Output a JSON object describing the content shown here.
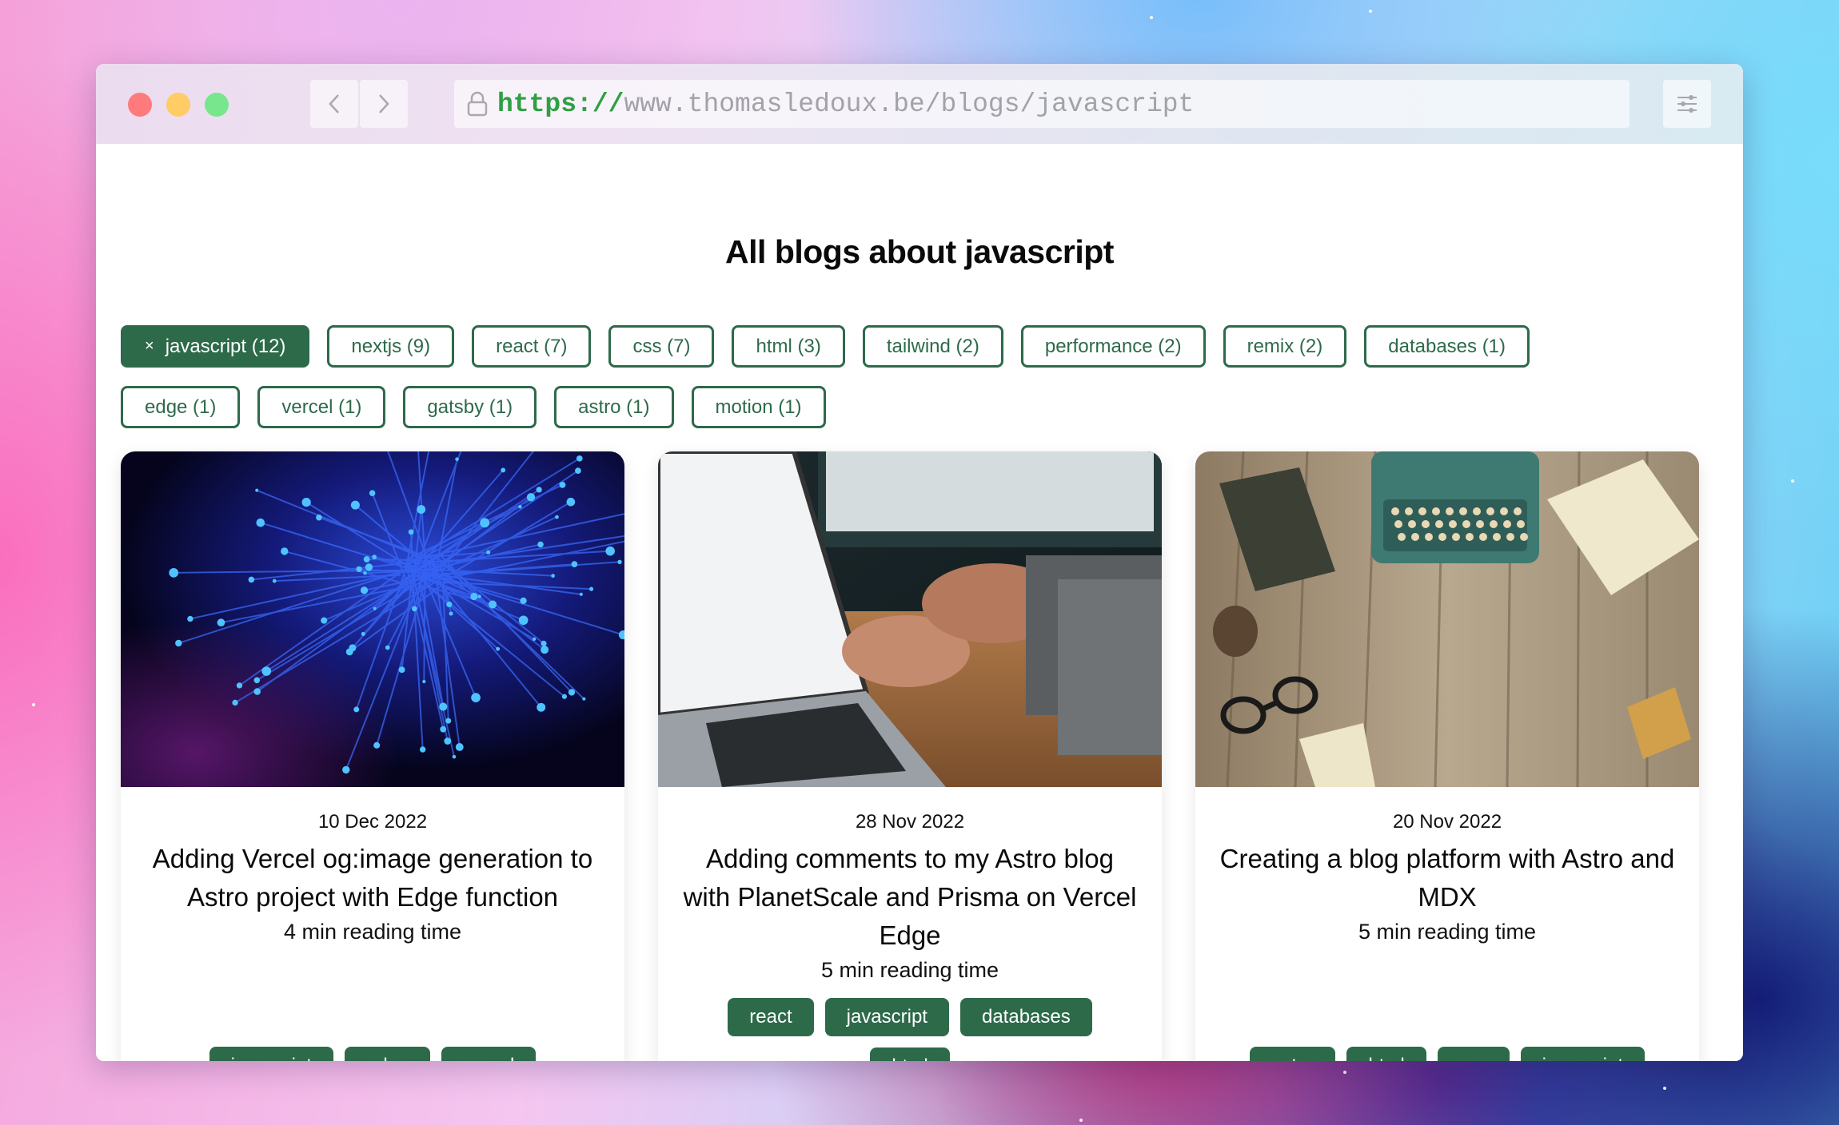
{
  "browser": {
    "url_scheme": "https://",
    "url_rest": "www.thomasledoux.be/blogs/javascript",
    "back_icon": "chevron-left",
    "forward_icon": "chevron-right",
    "settings_icon": "sliders"
  },
  "page": {
    "title": "All blogs about javascript"
  },
  "filters": {
    "row1": [
      {
        "label": "javascript (12)",
        "active": true
      },
      {
        "label": "nextjs (9)"
      },
      {
        "label": "react (7)"
      },
      {
        "label": "css (7)"
      },
      {
        "label": "html (3)"
      },
      {
        "label": "tailwind (2)"
      },
      {
        "label": "performance (2)"
      },
      {
        "label": "remix (2)"
      },
      {
        "label": "databases (1)"
      }
    ],
    "row2": [
      {
        "label": "edge (1)"
      },
      {
        "label": "vercel (1)"
      },
      {
        "label": "gatsby (1)"
      },
      {
        "label": "astro (1)"
      },
      {
        "label": "motion (1)"
      }
    ],
    "remove_icon": "×"
  },
  "posts": [
    {
      "date": "10 Dec 2022",
      "title": "Adding Vercel og:image generation to Astro project with Edge function",
      "reading_time": "4 min reading time",
      "image": "blue fiber optic lights",
      "tags": [
        "javascript",
        "edge",
        "vercel"
      ]
    },
    {
      "date": "28 Nov 2022",
      "title": "Adding comments to my Astro blog with PlanetScale and Prisma on Vercel Edge",
      "reading_time": "5 min reading time",
      "image": "hands typing on laptop",
      "tags": [
        "react",
        "javascript",
        "databases",
        "html"
      ]
    },
    {
      "date": "20 Nov 2022",
      "title": "Creating a blog platform with Astro and MDX",
      "reading_time": "5 min reading time",
      "image": "typewriter on wooden desk",
      "tags": [
        "astro",
        "html",
        "css",
        "javascript"
      ]
    }
  ],
  "colors": {
    "accent": "#2d6a4a",
    "url_scheme": "#2ea043"
  }
}
